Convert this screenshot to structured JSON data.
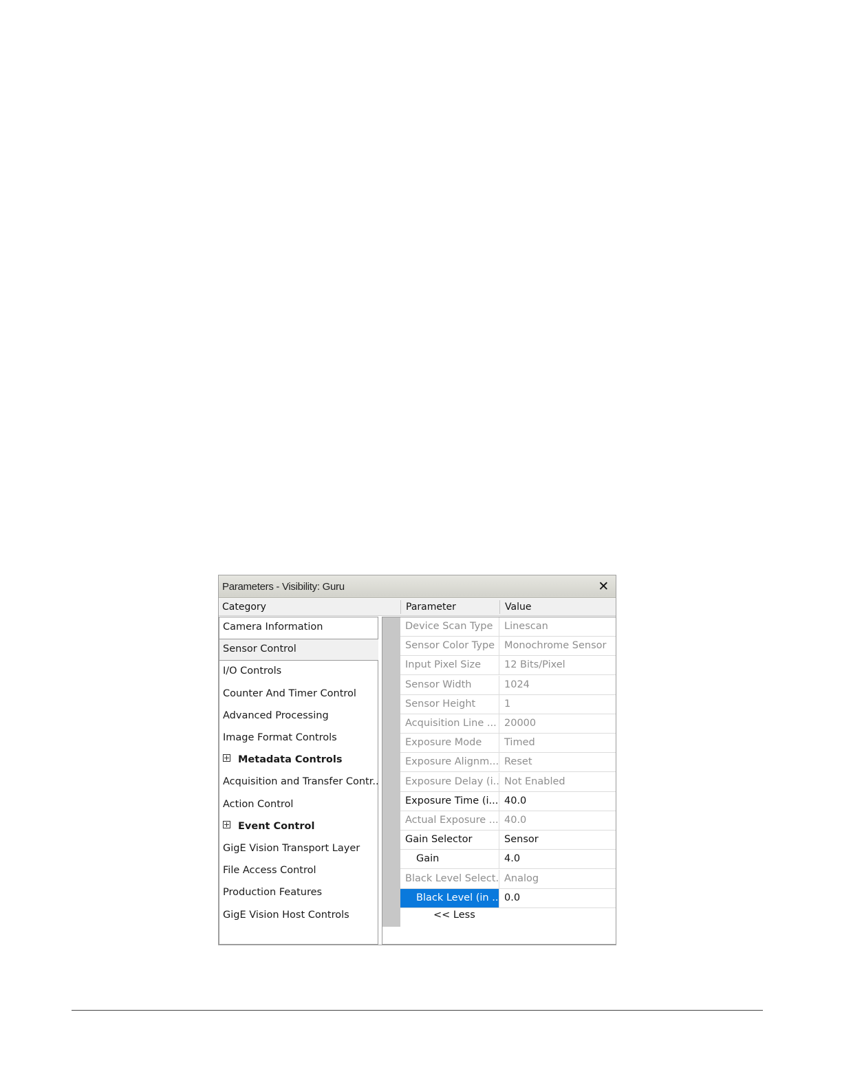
{
  "window": {
    "title": "Parameters - Visibility: Guru",
    "close_glyph": "✕"
  },
  "headers": {
    "category": "Category",
    "parameter": "Parameter",
    "value": "Value"
  },
  "categories": [
    {
      "label": "Camera Information",
      "bold": false,
      "expand": false
    },
    {
      "label": "Sensor Control",
      "bold": false,
      "expand": false,
      "selected": true
    },
    {
      "label": "I/O Controls",
      "bold": false,
      "expand": false
    },
    {
      "label": "Counter And Timer Control",
      "bold": false,
      "expand": false
    },
    {
      "label": "Advanced Processing",
      "bold": false,
      "expand": false
    },
    {
      "label": "Image Format Controls",
      "bold": false,
      "expand": false
    },
    {
      "label": "Metadata Controls",
      "bold": true,
      "expand": true
    },
    {
      "label": "Acquisition and Transfer Contr...",
      "bold": false,
      "expand": false
    },
    {
      "label": "Action Control",
      "bold": false,
      "expand": false
    },
    {
      "label": "Event Control",
      "bold": true,
      "expand": true
    },
    {
      "label": "GigE Vision Transport Layer",
      "bold": false,
      "expand": false
    },
    {
      "label": "File Access Control",
      "bold": false,
      "expand": false
    },
    {
      "label": "Production Features",
      "bold": false,
      "expand": false
    },
    {
      "label": "GigE Vision Host Controls",
      "bold": false,
      "expand": false
    }
  ],
  "parameters": [
    {
      "name": "Device Scan Type",
      "value": "Linescan",
      "readonly": true
    },
    {
      "name": "Sensor Color Type",
      "value": "Monochrome Sensor",
      "readonly": true
    },
    {
      "name": "Input Pixel Size",
      "value": "12 Bits/Pixel",
      "readonly": true
    },
    {
      "name": "Sensor Width",
      "value": "1024",
      "readonly": true
    },
    {
      "name": "Sensor Height",
      "value": "1",
      "readonly": true
    },
    {
      "name": "Acquisition Line ...",
      "value": "20000",
      "readonly": true
    },
    {
      "name": "Exposure Mode",
      "value": "Timed",
      "readonly": true
    },
    {
      "name": "Exposure Alignm...",
      "value": "Reset",
      "readonly": true
    },
    {
      "name": "Exposure Delay (i...",
      "value": "Not Enabled",
      "readonly": true
    },
    {
      "name": "Exposure Time (i...",
      "value": "40.0",
      "readonly": false
    },
    {
      "name": "Actual Exposure ...",
      "value": "40.0",
      "readonly": true
    },
    {
      "name": "Gain Selector",
      "value": "Sensor",
      "readonly": false
    },
    {
      "name": "Gain",
      "value": "4.0",
      "readonly": false,
      "indent": true
    },
    {
      "name": "Black Level Select...",
      "value": "Analog",
      "readonly": true
    },
    {
      "name": "Black Level (in ...",
      "value": "0.0",
      "readonly": false,
      "indent": true,
      "selected": true
    }
  ],
  "less_button": "<< Less",
  "colors": {
    "selection": "#0a79dc",
    "readonly_text": "#8e8e8e",
    "gutter": "#c7c7c7"
  }
}
